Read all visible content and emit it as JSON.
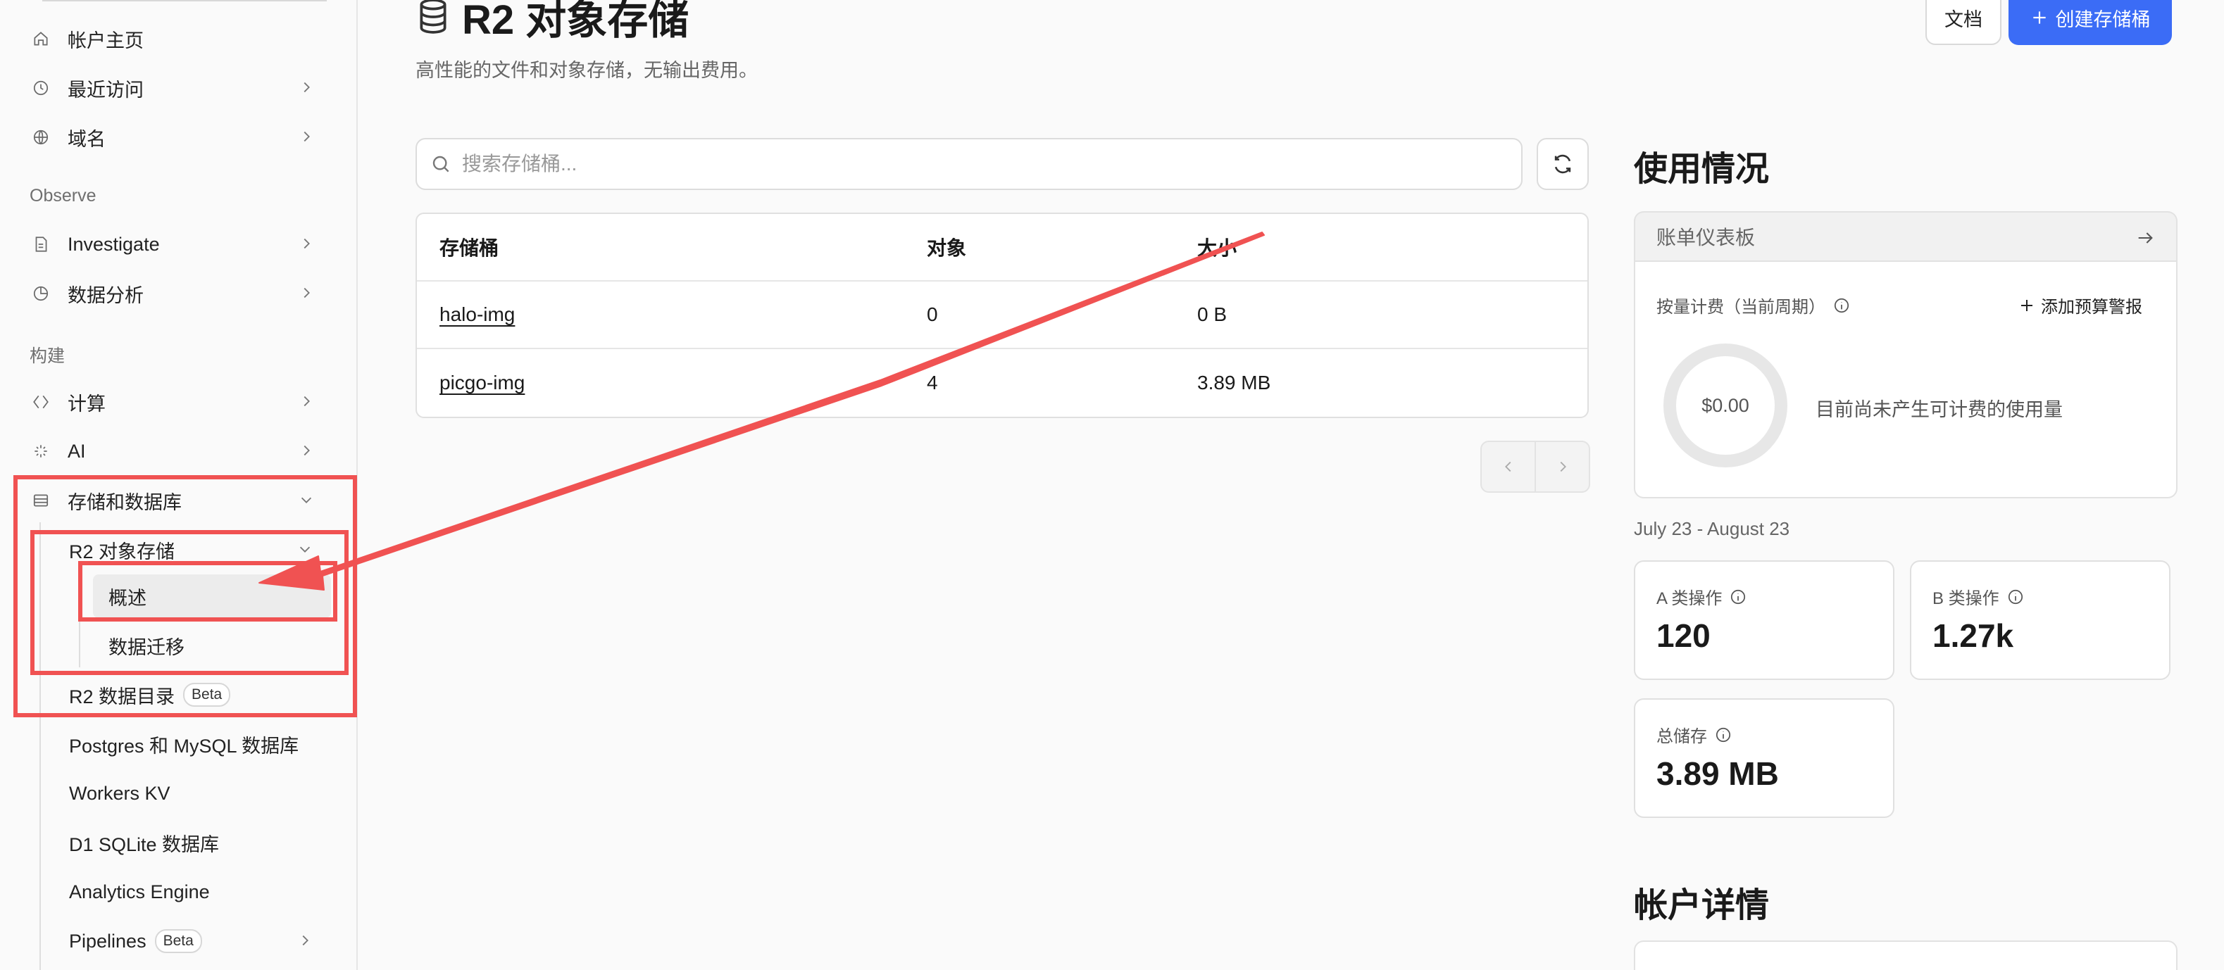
{
  "sidebar": {
    "top_items": [
      {
        "label": "帐户主页",
        "icon": "home-icon"
      },
      {
        "label": "最近访问",
        "icon": "clock-icon"
      },
      {
        "label": "域名",
        "icon": "globe-icon"
      }
    ],
    "section_observe": "Observe",
    "observe_items": [
      {
        "label": "Investigate",
        "icon": "document-search-icon"
      },
      {
        "label": "数据分析",
        "icon": "pie-chart-icon"
      }
    ],
    "section_build": "构建",
    "build_items": [
      {
        "label": "计算",
        "icon": "compute-icon"
      },
      {
        "label": "AI",
        "icon": "sparkle-icon"
      },
      {
        "label": "存储和数据库",
        "icon": "storage-icon"
      }
    ],
    "r2_label": "R2 对象存储",
    "r2_children": [
      "概述",
      "数据迁移"
    ],
    "r2_catalog": "R2 数据目录",
    "beta": "Beta",
    "db_items": [
      "Postgres 和 MySQL 数据库",
      "Workers KV",
      "D1 SQLite 数据库",
      "Analytics Engine"
    ],
    "pipelines": "Pipelines"
  },
  "header": {
    "title": "R2 对象存储",
    "subtitle": "高性能的文件和对象存储，无输出费用。",
    "docs_button": "文档",
    "create_button": "创建存储桶"
  },
  "search": {
    "placeholder": "搜索存储桶..."
  },
  "table": {
    "columns": [
      "存储桶",
      "对象",
      "大小"
    ],
    "rows": [
      {
        "name": "halo-img",
        "objects": "0",
        "size": "0 B"
      },
      {
        "name": "picgo-img",
        "objects": "4",
        "size": "3.89 MB"
      }
    ]
  },
  "usage": {
    "title": "使用情况",
    "billing_link": "账单仪表板",
    "metered_label": "按量计费（当前周期）",
    "add_alert": "添加预算警报",
    "amount": "$0.00",
    "note": "目前尚未产生可计费的使用量",
    "period": "July 23 - August 23",
    "metrics": [
      {
        "label": "A 类操作",
        "value": "120"
      },
      {
        "label": "B 类操作",
        "value": "1.27k"
      },
      {
        "label": "总储存",
        "value": "3.89 MB"
      }
    ]
  },
  "account": {
    "title": "帐户详情"
  },
  "colors": {
    "accent": "#3b6cf6",
    "annotation": "#f05252"
  }
}
